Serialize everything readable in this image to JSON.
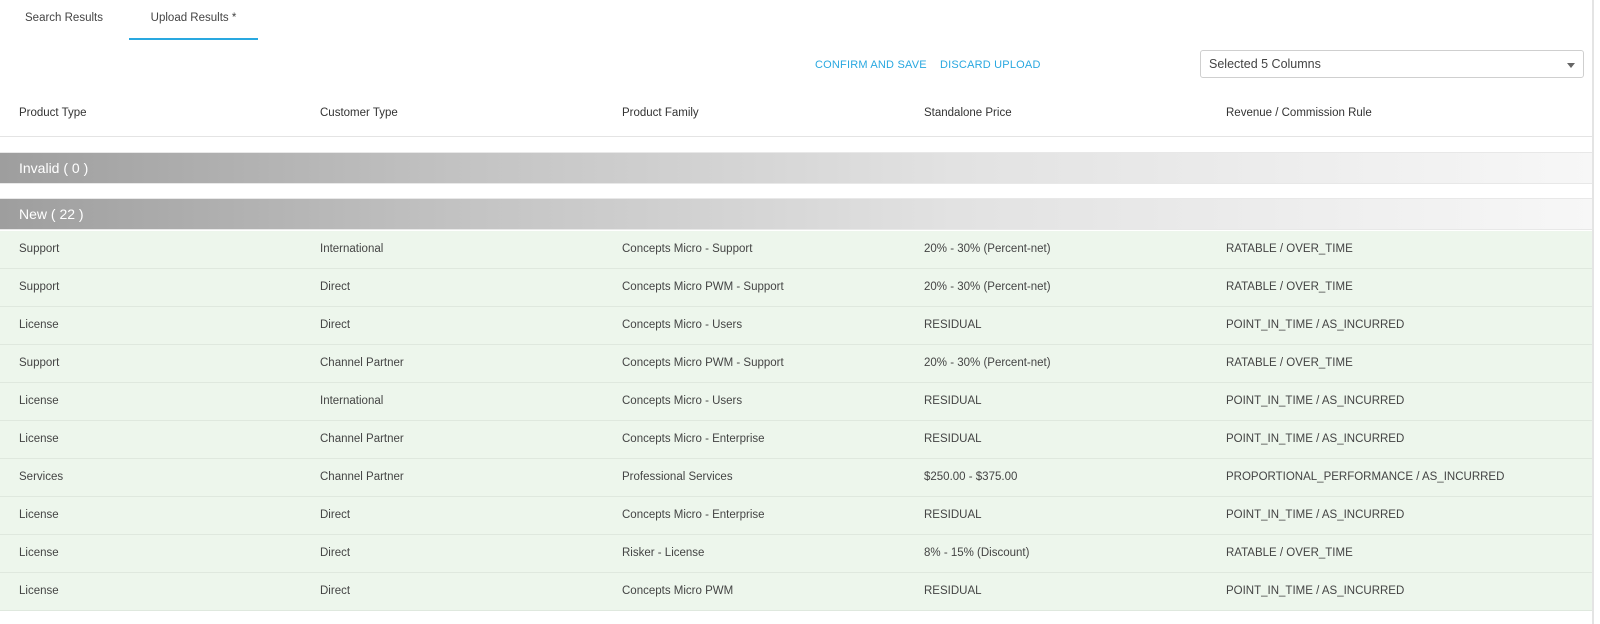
{
  "tabs": [
    {
      "label": "Search Results",
      "active": false
    },
    {
      "label": "Upload Results *",
      "active": true
    }
  ],
  "actions": {
    "confirm": "CONFIRM AND SAVE",
    "discard": "DISCARD UPLOAD"
  },
  "column_selector": {
    "value": "Selected 5 Columns"
  },
  "columns": [
    "Product Type",
    "Customer Type",
    "Product Family",
    "Standalone Price",
    "Revenue / Commission Rule"
  ],
  "groups": {
    "invalid": "Invalid ( 0 )",
    "new": "New ( 22 )"
  },
  "rows": [
    [
      "Support",
      "International",
      "Concepts Micro - Support",
      "20% - 30% (Percent-net)",
      "RATABLE / OVER_TIME"
    ],
    [
      "Support",
      "Direct",
      "Concepts Micro PWM - Support",
      "20% - 30% (Percent-net)",
      "RATABLE / OVER_TIME"
    ],
    [
      "License",
      "Direct",
      "Concepts Micro - Users",
      "RESIDUAL",
      "POINT_IN_TIME / AS_INCURRED"
    ],
    [
      "Support",
      "Channel Partner",
      "Concepts Micro PWM - Support",
      "20% - 30% (Percent-net)",
      "RATABLE / OVER_TIME"
    ],
    [
      "License",
      "International",
      "Concepts Micro - Users",
      "RESIDUAL",
      "POINT_IN_TIME / AS_INCURRED"
    ],
    [
      "License",
      "Channel Partner",
      "Concepts Micro - Enterprise",
      "RESIDUAL",
      "POINT_IN_TIME / AS_INCURRED"
    ],
    [
      "Services",
      "Channel Partner",
      "Professional Services",
      "$250.00 - $375.00",
      "PROPORTIONAL_PERFORMANCE / AS_INCURRED"
    ],
    [
      "License",
      "Direct",
      "Concepts Micro - Enterprise",
      "RESIDUAL",
      "POINT_IN_TIME / AS_INCURRED"
    ],
    [
      "License",
      "Direct",
      "Risker - License",
      "8% - 15% (Discount)",
      "RATABLE / OVER_TIME"
    ],
    [
      "License",
      "Direct",
      "Concepts Micro PWM",
      "RESIDUAL",
      "POINT_IN_TIME / AS_INCURRED"
    ]
  ],
  "colors": {
    "accent": "#29a8e0",
    "row_bg": "#edf6ec"
  },
  "icons": {
    "select_caret": "chevron-down-icon"
  }
}
